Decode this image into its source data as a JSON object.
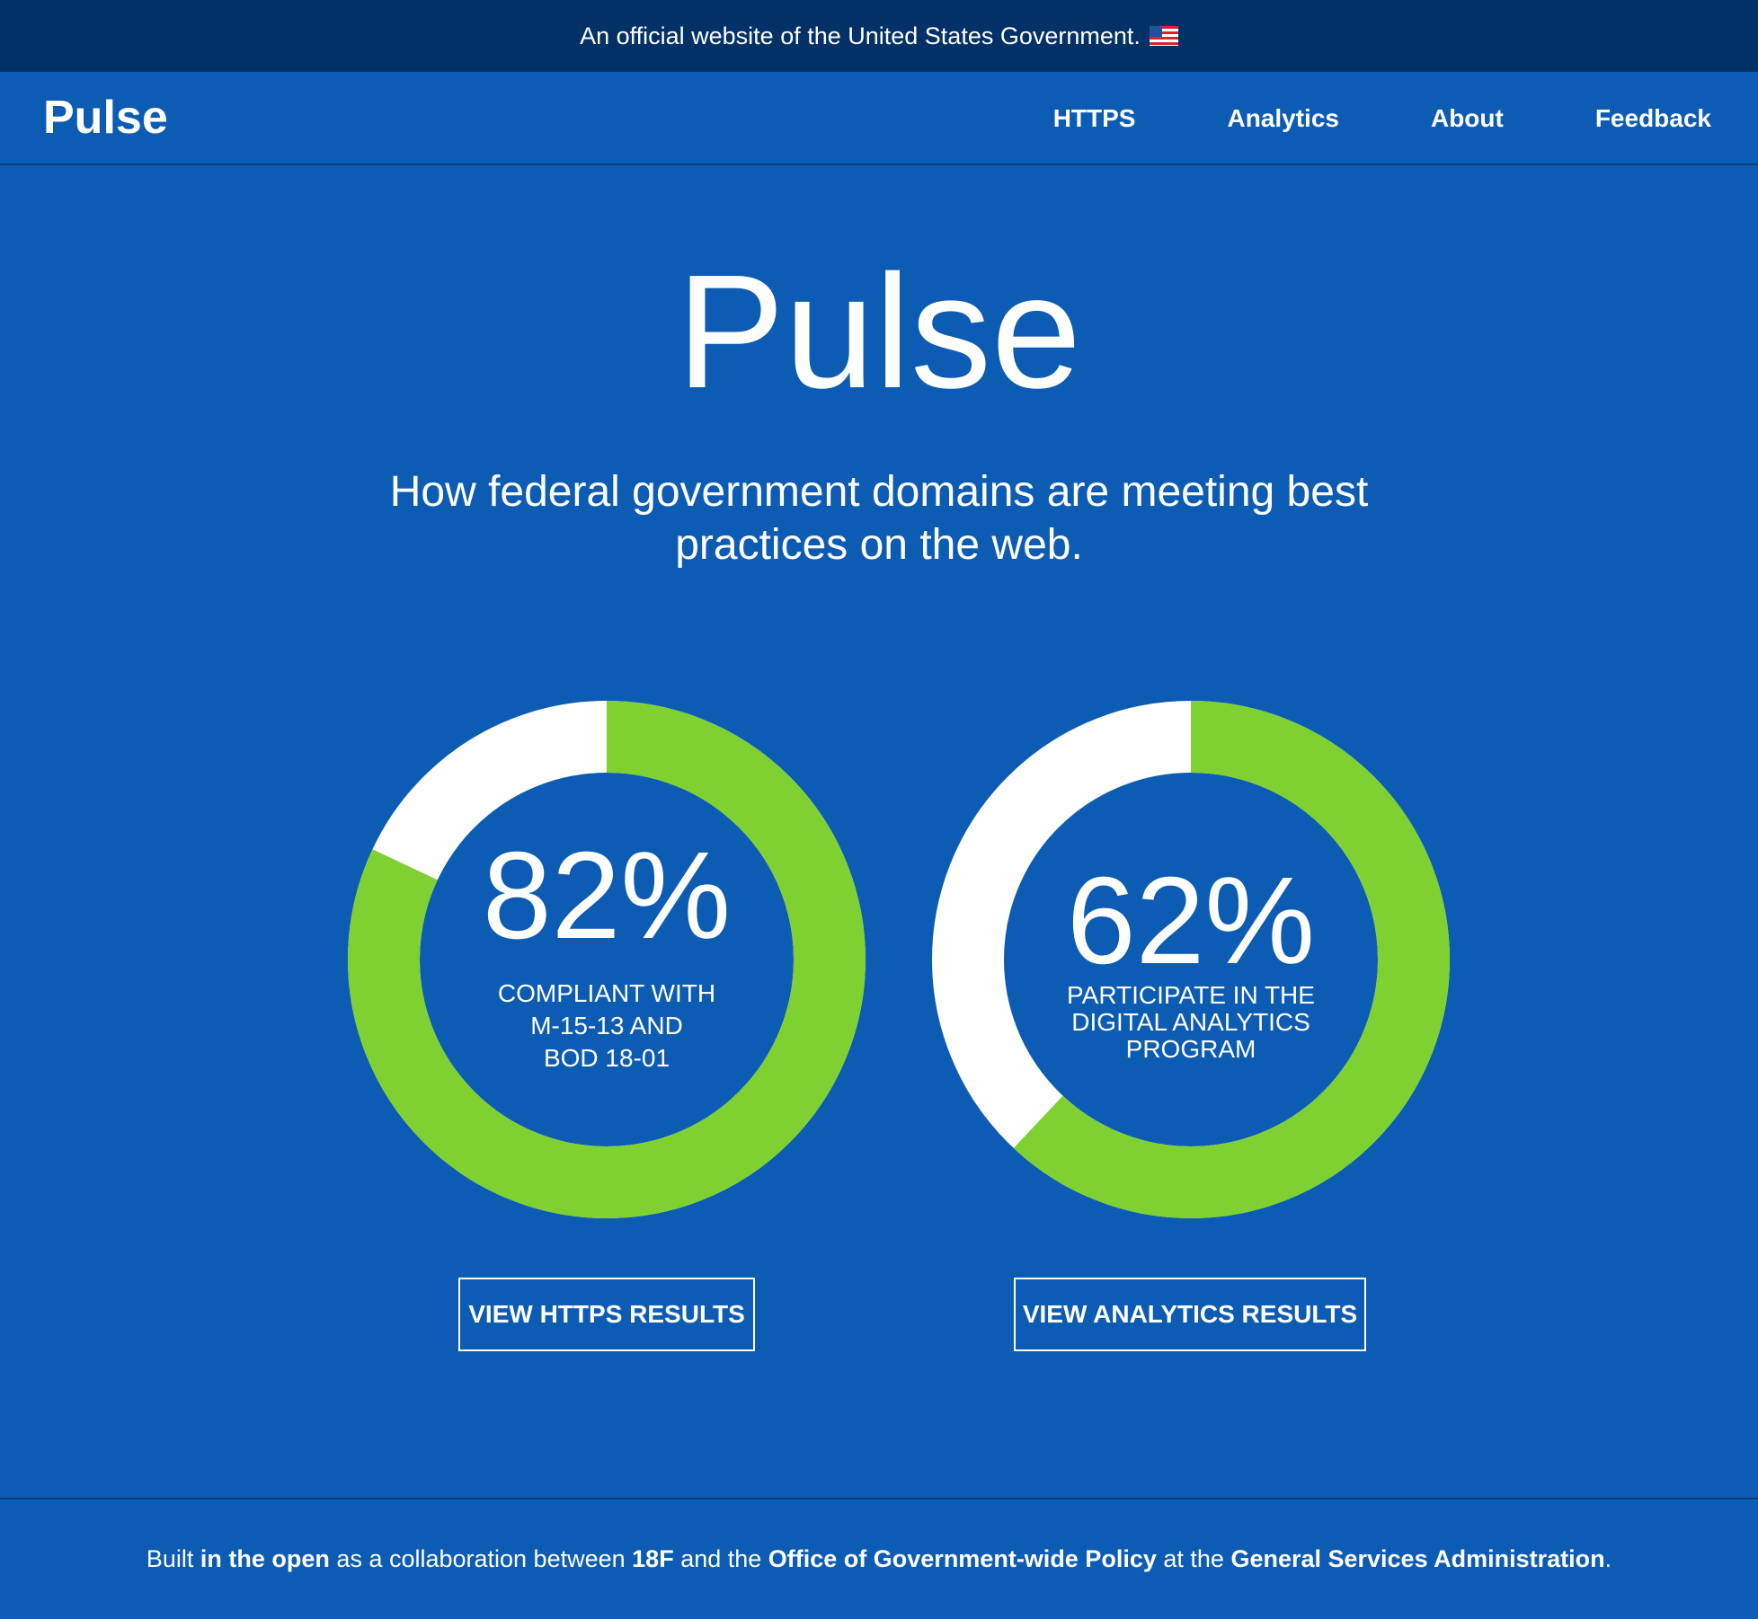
{
  "gov_banner": {
    "text": "An official website of the United States Government.",
    "flag_icon": "us-flag-icon"
  },
  "header": {
    "title": "Pulse",
    "nav": [
      {
        "label": "HTTPS"
      },
      {
        "label": "Analytics"
      },
      {
        "label": "About"
      },
      {
        "label": "Feedback"
      }
    ]
  },
  "hero": {
    "title": "Pulse",
    "subtitle": "How federal government domains are meeting best practices on the web."
  },
  "stats": {
    "https": {
      "percent_label": "82%",
      "percent": 82,
      "desc_lines": [
        "COMPLIANT WITH",
        "M-15-13 AND",
        "BOD 18-01"
      ],
      "button": "VIEW HTTPS RESULTS"
    },
    "analytics": {
      "percent_label": "62%",
      "percent": 62,
      "desc_lines": [
        "PARTICIPATE IN THE",
        "DIGITAL ANALYTICS",
        "PROGRAM"
      ],
      "button": "VIEW ANALYTICS RESULTS"
    }
  },
  "colors": {
    "background": "#0d5cb3",
    "banner": "#023168",
    "progress": "#7fd132",
    "track": "#ffffff"
  },
  "footer": {
    "t1": "Built ",
    "l1": "in the open",
    "t2": " as a collaboration between ",
    "l2": "18F",
    "t3": " and the ",
    "l3": "Office of Government-wide Policy",
    "t4": " at the ",
    "l4": "General Services Administration",
    "t5": "."
  }
}
